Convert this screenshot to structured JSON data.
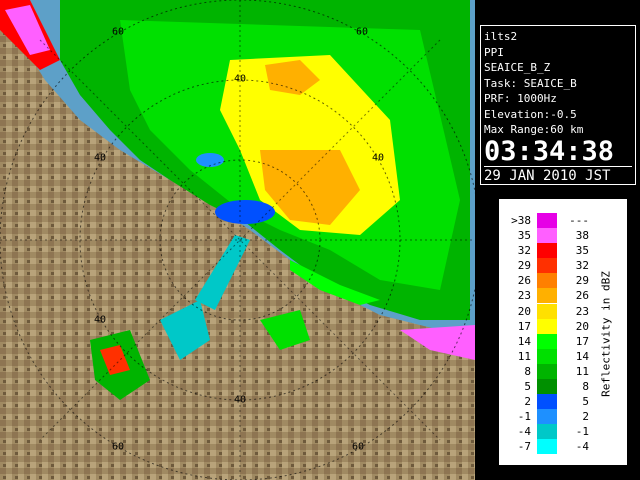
{
  "info": {
    "station": "ilts2",
    "scan_type": "PPI",
    "product": "SEAICE_B_Z",
    "task": "Task: SEAICE_B",
    "prf": "PRF: 1000Hz",
    "elevation": "Elevation:-0.5",
    "max_range": "Max Range:60 km",
    "time": "03:34:38",
    "date": "29 JAN 2010 JST"
  },
  "range_rings": {
    "labels": [
      "60",
      "40",
      "40",
      "60",
      "40",
      "40",
      "40",
      "60",
      "60"
    ]
  },
  "legend": {
    "unit_label": "Reflectivity in dBZ",
    "rows": [
      {
        "lo": ">38",
        "hi": "---",
        "color": "#e600e6"
      },
      {
        "lo": "35",
        "hi": "38",
        "color": "#ff5fff"
      },
      {
        "lo": "32",
        "hi": "35",
        "color": "#ff0000"
      },
      {
        "lo": "29",
        "hi": "32",
        "color": "#ff3000"
      },
      {
        "lo": "26",
        "hi": "29",
        "color": "#ff8000"
      },
      {
        "lo": "23",
        "hi": "26",
        "color": "#ffb000"
      },
      {
        "lo": "20",
        "hi": "23",
        "color": "#ffe000"
      },
      {
        "lo": "17",
        "hi": "20",
        "color": "#ffff00"
      },
      {
        "lo": "14",
        "hi": "17",
        "color": "#00ff00"
      },
      {
        "lo": "11",
        "hi": "14",
        "color": "#00e000"
      },
      {
        "lo": "8",
        "hi": "11",
        "color": "#00b400"
      },
      {
        "lo": "5",
        "hi": "8",
        "color": "#009000"
      },
      {
        "lo": "2",
        "hi": "5",
        "color": "#0050ff"
      },
      {
        "lo": "-1",
        "hi": "2",
        "color": "#1e90ff"
      },
      {
        "lo": "-4",
        "hi": "-1",
        "color": "#00c8c8"
      },
      {
        "lo": "-7",
        "hi": "-4",
        "color": "#00ffff"
      }
    ]
  }
}
